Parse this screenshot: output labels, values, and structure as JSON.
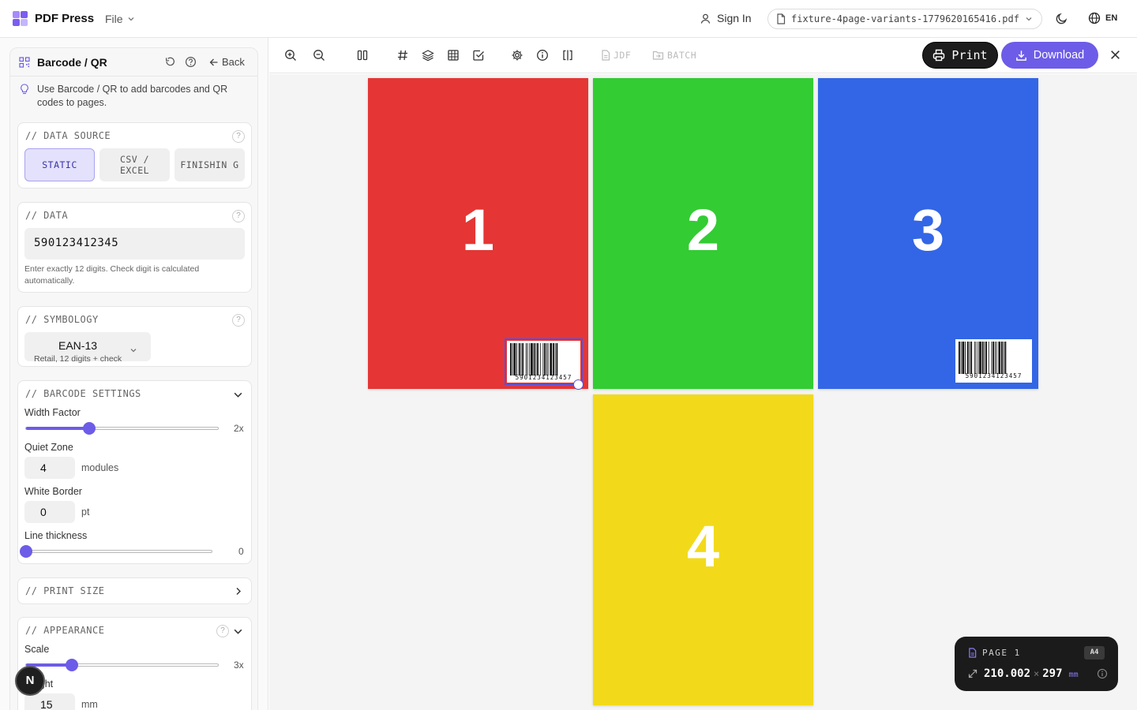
{
  "app": {
    "title": "PDF Press",
    "file_menu": "File"
  },
  "header": {
    "sign_in": "Sign In",
    "file_name": "fixture-4page-variants-1779620165416.pdf",
    "language": "EN"
  },
  "sidebar": {
    "title": "Barcode / QR",
    "back_label": "Back",
    "tip": "Use Barcode / QR to add barcodes and QR codes to pages.",
    "data_source": {
      "label": "// DATA SOURCE",
      "options": [
        "STATIC",
        "CSV / EXCEL",
        "FINISHIN G"
      ],
      "selected": "STATIC"
    },
    "data": {
      "label": "// DATA",
      "value": "590123412345",
      "hint": "Enter exactly 12 digits. Check digit is calculated automatically."
    },
    "symbology": {
      "label": "// SYMBOLOGY",
      "value": "EAN-13",
      "subtitle": "Retail, 12 digits + check"
    },
    "barcode_settings": {
      "label": "// BARCODE SETTINGS",
      "width_factor_label": "Width Factor",
      "width_factor_value": "2x",
      "width_factor_fraction": 0.33,
      "quiet_zone_label": "Quiet Zone",
      "quiet_zone_value": "4",
      "quiet_zone_unit": "modules",
      "white_border_label": "White Border",
      "white_border_value": "0",
      "white_border_unit": "pt",
      "line_thickness_label": "Line thickness",
      "line_thickness_value": "0",
      "line_thickness_fraction": 0
    },
    "print_size": {
      "label": "// PRINT SIZE"
    },
    "appearance": {
      "label": "// APPEARANCE",
      "scale_label": "Scale",
      "scale_value": "3x",
      "scale_fraction": 0.24,
      "height_label": "Height",
      "height_value": "15",
      "height_unit": "mm"
    },
    "badge_letter": "N"
  },
  "toolbar": {
    "jdf_label": "JDF",
    "batch_label": "BATCH",
    "print_label": "Print",
    "download_label": "Download"
  },
  "pages": [
    {
      "number": "1",
      "color": "#e53535"
    },
    {
      "number": "2",
      "color": "#33cc33"
    },
    {
      "number": "3",
      "color": "#3366e6"
    },
    {
      "number": "4",
      "color": "#f2da1a"
    }
  ],
  "barcode_digits": "5901234123457",
  "page_info": {
    "label": "PAGE 1",
    "size": "A4",
    "width": "210.002",
    "separator": "×",
    "height": "297",
    "unit": "mm"
  },
  "colors": {
    "accent": "#6d5ce8",
    "dark": "#1c1c1c"
  }
}
